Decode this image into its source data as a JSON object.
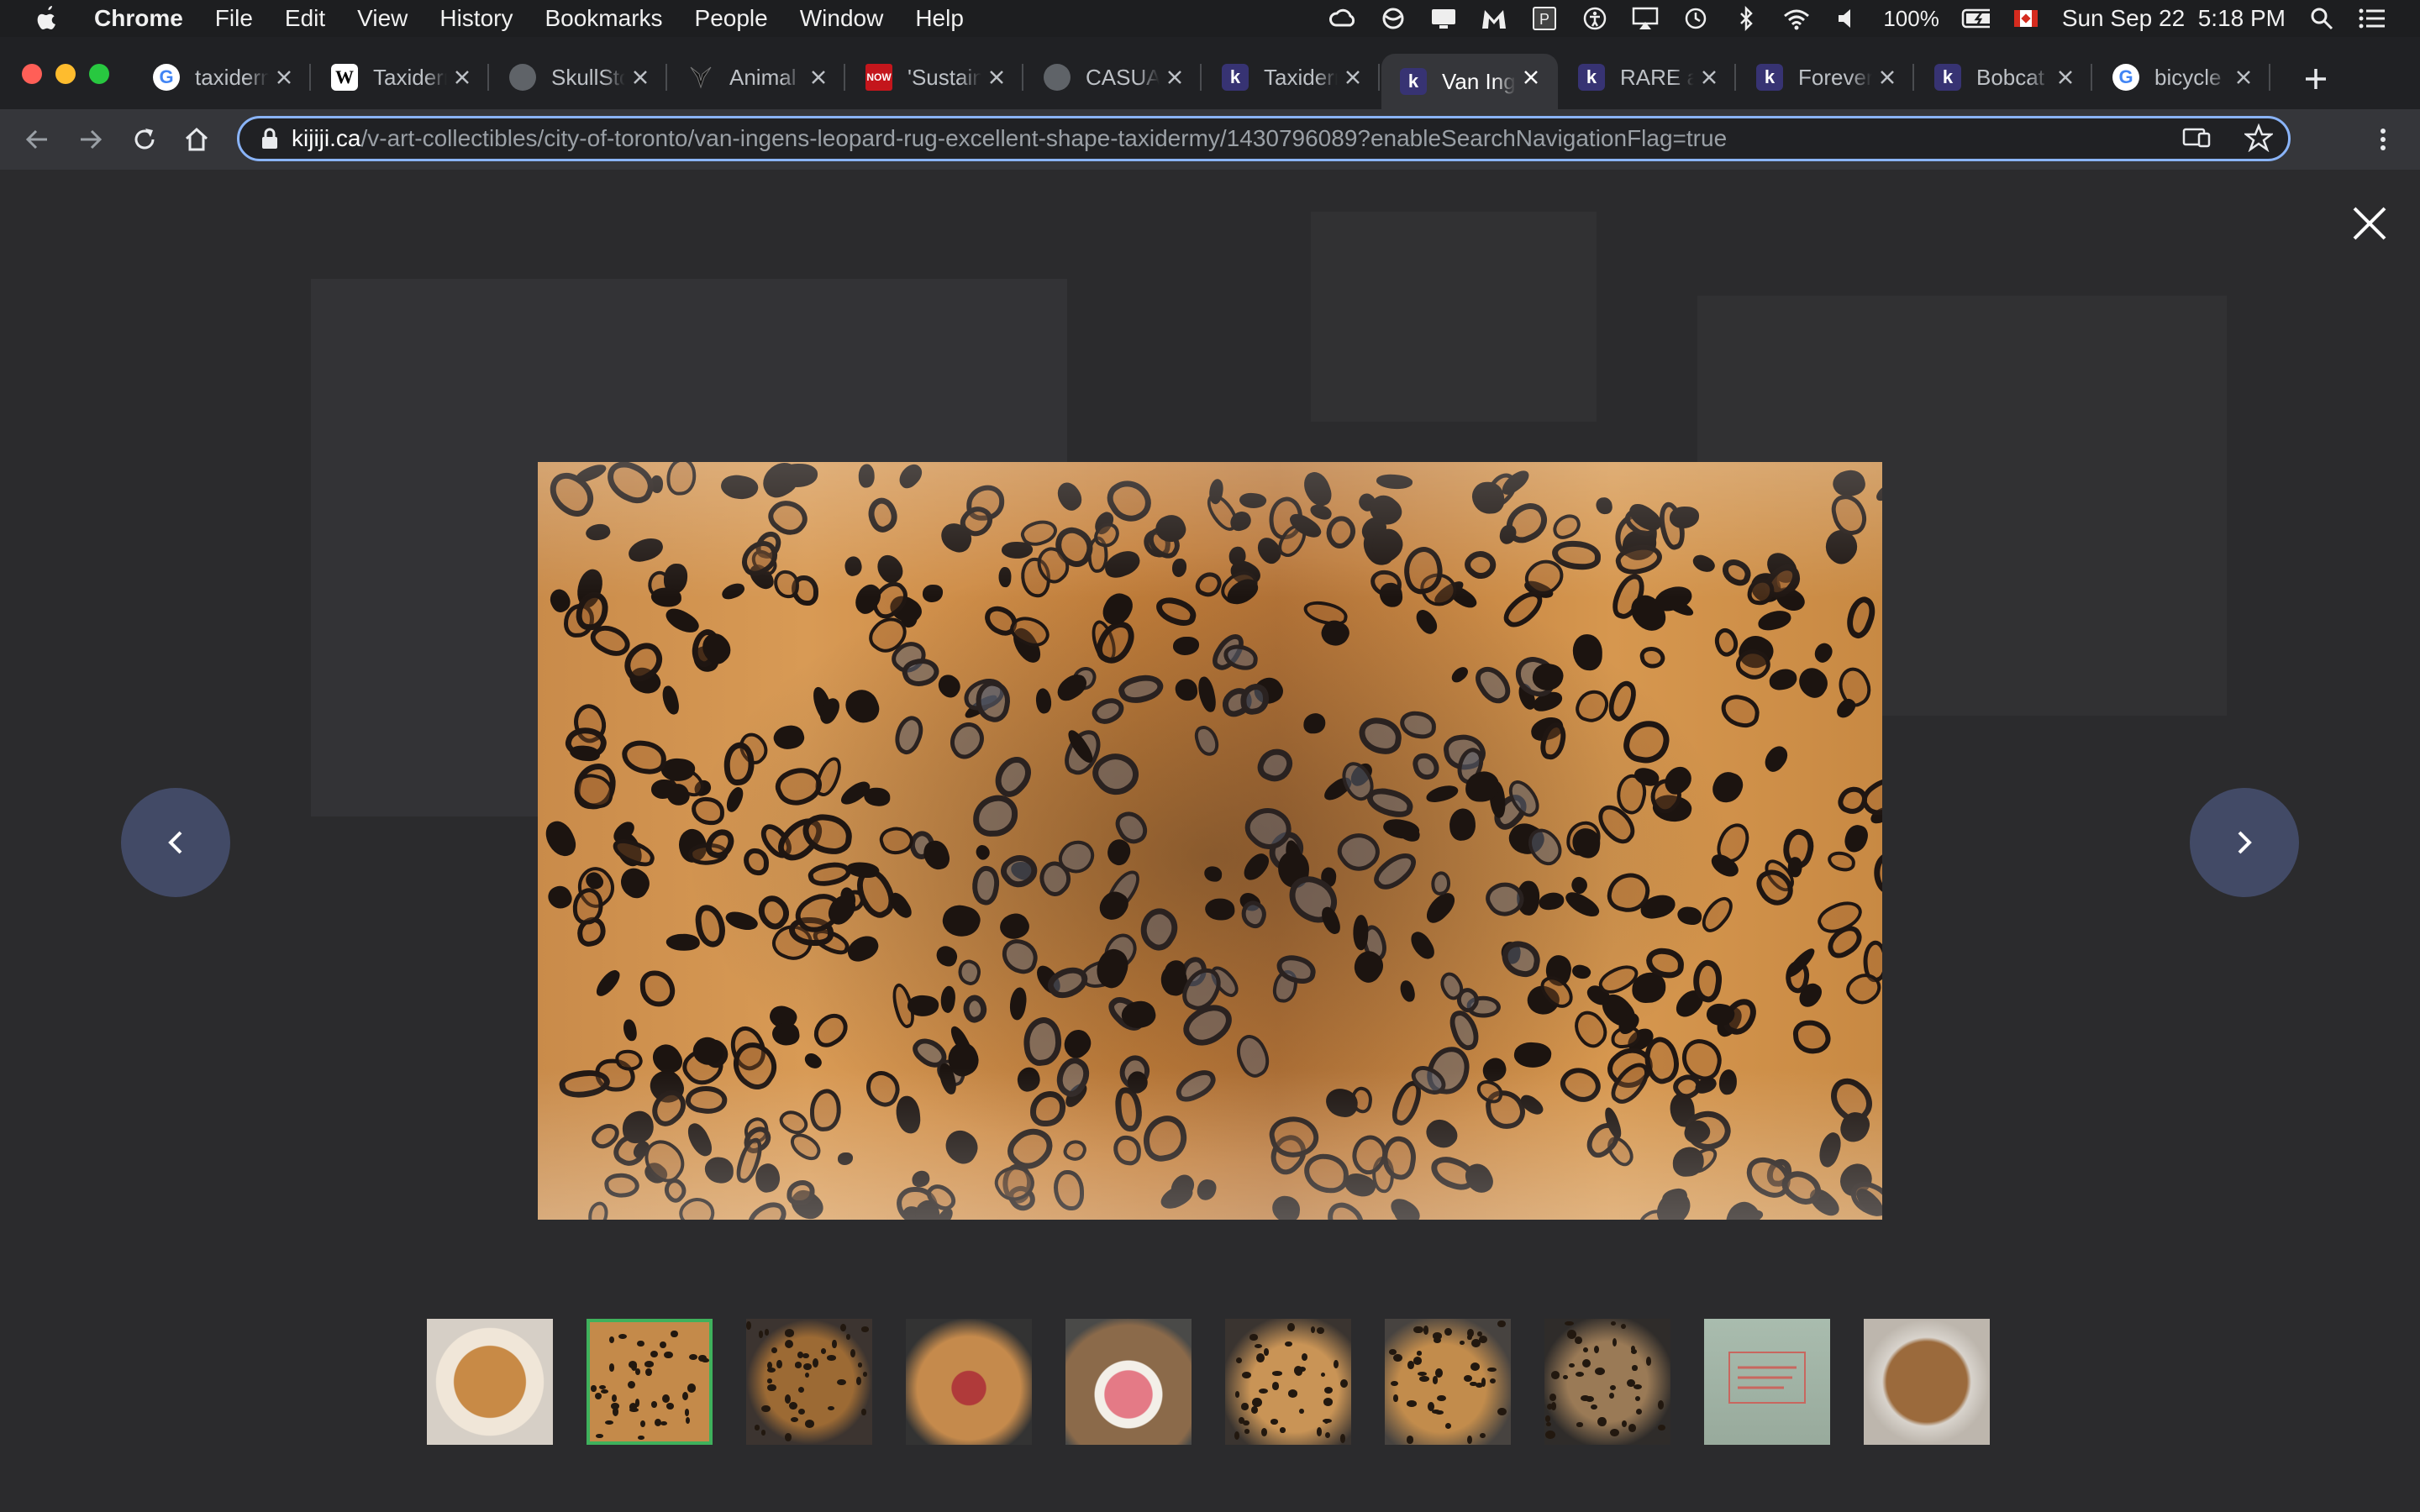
{
  "menubar": {
    "app": "Chrome",
    "items": [
      "File",
      "Edit",
      "View",
      "History",
      "Bookmarks",
      "People",
      "Window",
      "Help"
    ],
    "battery": "100%",
    "datetime": "Sun Sep 22  5:18 PM"
  },
  "tabs": [
    {
      "title": "taxiderm",
      "favicon": "google-icon"
    },
    {
      "title": "Taxiderm",
      "favicon": "wikipedia-icon"
    },
    {
      "title": "SkullStor",
      "favicon": "globe-icon"
    },
    {
      "title": "Animal",
      "favicon": "antler-icon"
    },
    {
      "title": "'Sustain",
      "favicon": "now-icon"
    },
    {
      "title": "CASUAL",
      "favicon": "globe-icon"
    },
    {
      "title": "Taxiderm",
      "favicon": "kijiji-icon"
    },
    {
      "title": "Van Inge",
      "favicon": "kijiji-icon",
      "active": true
    },
    {
      "title": "RARE a",
      "favicon": "kijiji-icon"
    },
    {
      "title": "Forever",
      "favicon": "kijiji-icon"
    },
    {
      "title": "Bobcat",
      "favicon": "kijiji-icon"
    },
    {
      "title": "bicycle",
      "favicon": "google-icon"
    }
  ],
  "address": {
    "host": "kijiji.ca",
    "path": "/v-art-collectibles/city-of-toronto/van-ingens-leopard-rug-excellent-shape-taxidermy/1430796089?enableSearchNavigationFlag=true"
  },
  "gallery": {
    "thumbnails": [
      {
        "name": "thumb-rug-full"
      },
      {
        "name": "thumb-rug-fur",
        "selected": true
      },
      {
        "name": "thumb-rug-back"
      },
      {
        "name": "thumb-head-snarl"
      },
      {
        "name": "thumb-mouth-teeth"
      },
      {
        "name": "thumb-head-side"
      },
      {
        "name": "thumb-head-profile"
      },
      {
        "name": "thumb-head-top"
      },
      {
        "name": "thumb-label"
      },
      {
        "name": "thumb-rug-felt"
      }
    ]
  },
  "colors": {
    "selected_border": "#3fb15c",
    "arrow_button": "#424a66",
    "omnibox_focus": "#8ab4f8",
    "kijiji_favicon": "#373373"
  }
}
